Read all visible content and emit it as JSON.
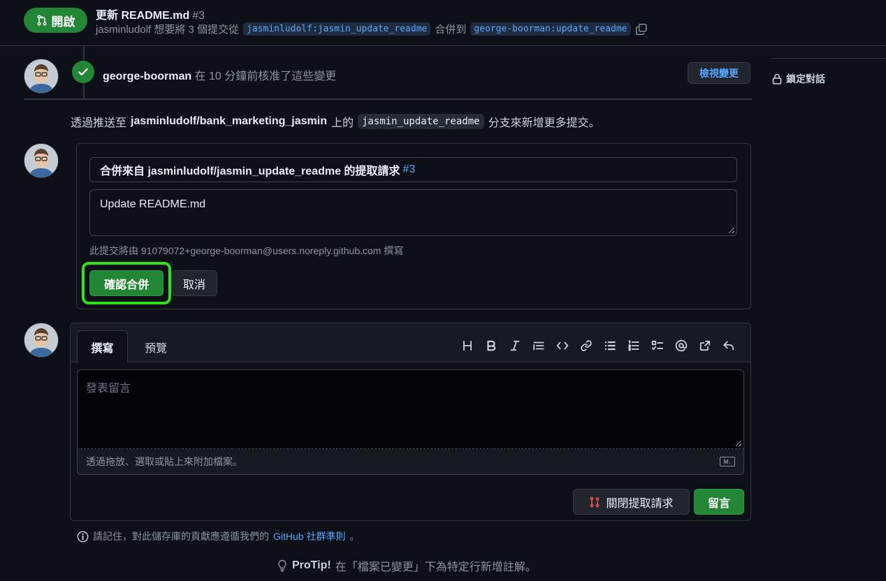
{
  "header": {
    "state_label": "開啟",
    "title": "更新 README.md",
    "number": "#3",
    "subtitle_prefix": "jasminludolf 想要將 3 個提交從",
    "head_branch": "jasminludolf:jasmin_update_readme",
    "subtitle_middle": "合併到",
    "base_branch": "george-boorman:update_readme"
  },
  "sidebar": {
    "lock_label": "鎖定對話"
  },
  "approval": {
    "user": "george-boorman",
    "text": "在 10 分鐘前核准了這些變更",
    "review_button": "檢視變更"
  },
  "push_note": {
    "prefix": "透過推送至",
    "repo": "jasminludolf/bank_marketing_jasmin",
    "middle": "上的",
    "branch": "jasmin_update_readme",
    "suffix": "分支來新增更多提交。"
  },
  "merge": {
    "title_text": "合併來自 jasminludolf/jasmin_update_readme 的提取請求",
    "title_number": "#3",
    "body_text": "Update README.md",
    "author_note": "此提交將由 91079072+george-boorman@users.noreply.github.com 撰寫",
    "confirm_label": "確認合併",
    "cancel_label": "取消"
  },
  "comment": {
    "tab_write": "撰寫",
    "tab_preview": "預覽",
    "toolbar": [
      "heading-icon",
      "bold-icon",
      "italic-icon",
      "quote-icon",
      "code-icon",
      "link-icon",
      "bulleted-list-icon",
      "numbered-list-icon",
      "task-list-icon",
      "mention-icon",
      "cross-reference-icon",
      "reply-icon"
    ],
    "placeholder": "發表留言",
    "attach_text": "透過拖放、選取或貼上來附加檔案。",
    "md_label": "M↓",
    "close_pr_label": "關閉提取請求",
    "comment_label": "留言"
  },
  "footer": {
    "remember_text": "請記住，對此儲存庫的貢獻應遵循我們的",
    "guidelines_link": "GitHub 社群準則",
    "remember_suffix": "。",
    "protip_label": "ProTip!",
    "protip_text": "在「檔案已變更」下為特定行新增註解。"
  },
  "colors": {
    "background": "#0d1117",
    "accent_green": "#238636",
    "link_blue": "#58a6ff",
    "highlight": "#2fe01b",
    "danger": "#f85149"
  }
}
